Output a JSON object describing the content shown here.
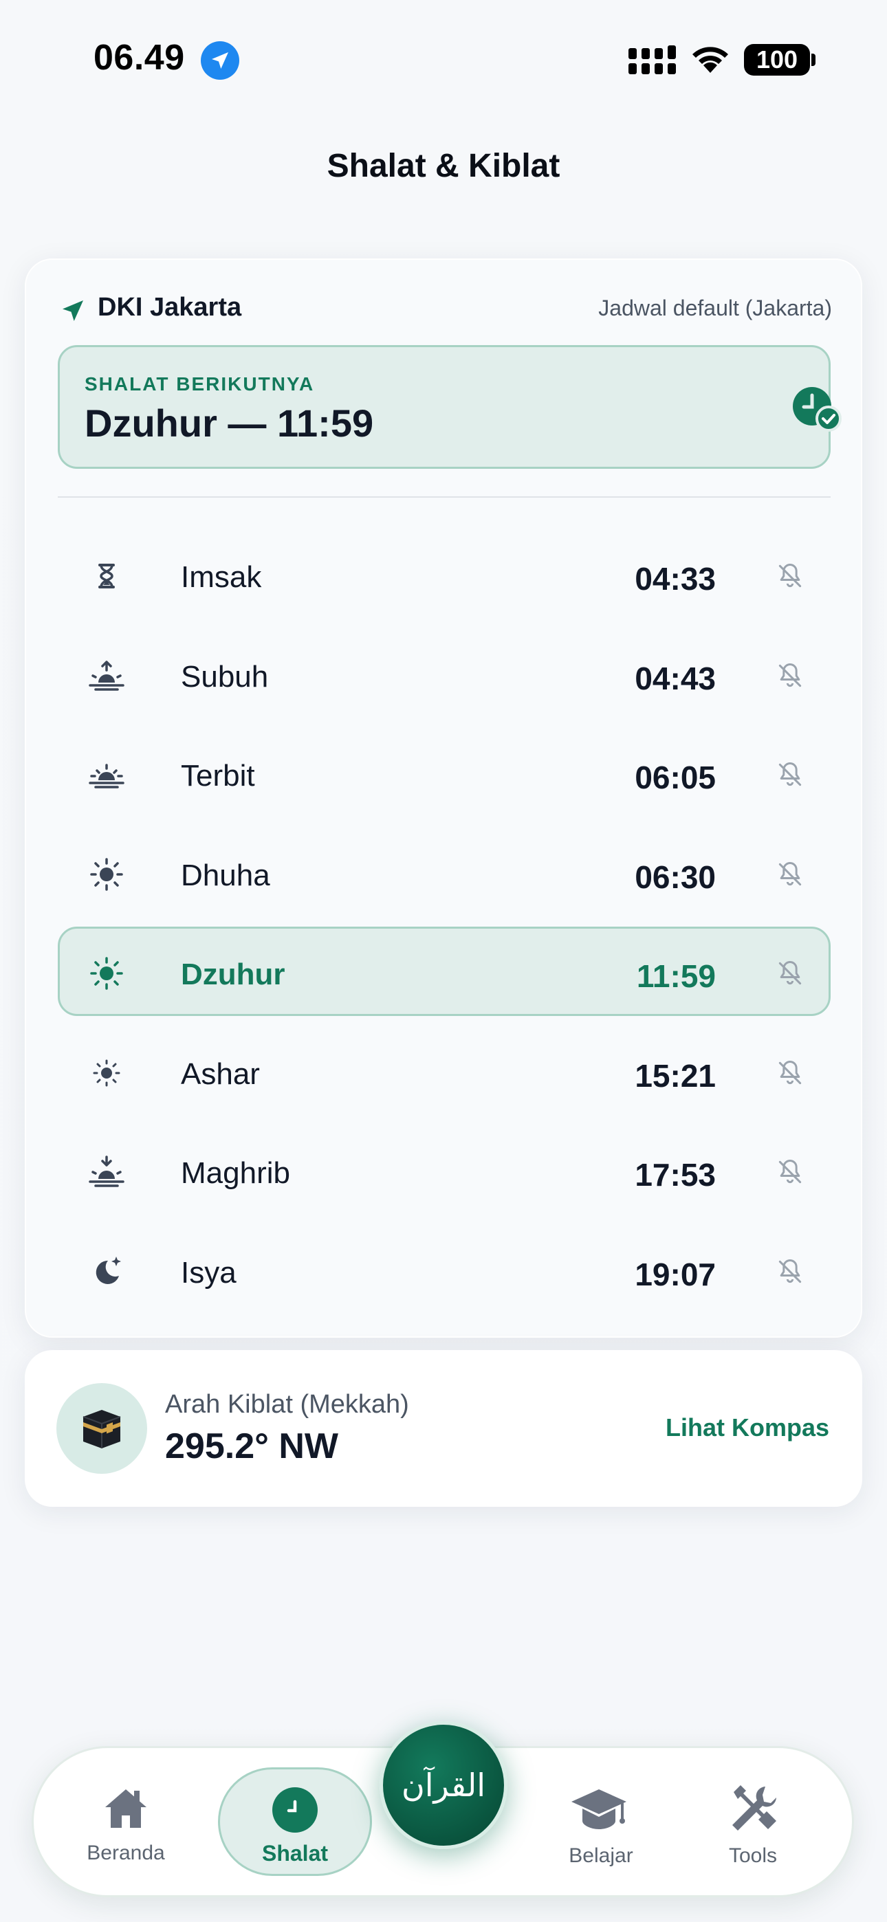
{
  "status_bar": {
    "time": "06.49",
    "battery": "100"
  },
  "page": {
    "title": "Shalat & Kiblat"
  },
  "location": {
    "name": "DKI Jakarta",
    "note": "Jadwal default (Jakarta)"
  },
  "next_prayer": {
    "label": "SHALAT BERIKUTNYA",
    "value": "Dzuhur — 11:59"
  },
  "prayers": [
    {
      "name": "Imsak",
      "time": "04:33",
      "icon": "hourglass-icon"
    },
    {
      "name": "Subuh",
      "time": "04:43",
      "icon": "sunrise-icon"
    },
    {
      "name": "Terbit",
      "time": "06:05",
      "icon": "sun-horizon-icon"
    },
    {
      "name": "Dhuha",
      "time": "06:30",
      "icon": "sun-icon"
    },
    {
      "name": "Dzuhur",
      "time": "11:59",
      "icon": "sun-icon",
      "active": true
    },
    {
      "name": "Ashar",
      "time": "15:21",
      "icon": "sun-small-icon"
    },
    {
      "name": "Maghrib",
      "time": "17:53",
      "icon": "sunset-icon"
    },
    {
      "name": "Isya",
      "time": "19:07",
      "icon": "moon-star-icon"
    }
  ],
  "qibla": {
    "label": "Arah Kiblat (Mekkah)",
    "value": "295.2° NW",
    "link": "Lihat Kompas"
  },
  "nav": {
    "home": "Beranda",
    "shalat": "Shalat",
    "quran": "القرآن",
    "learn": "Belajar",
    "tools": "Tools"
  },
  "colors": {
    "accent": "#13795b",
    "accent_bg": "#e1eeeb",
    "accent_border": "#a7d2c4",
    "text": "#111827"
  }
}
